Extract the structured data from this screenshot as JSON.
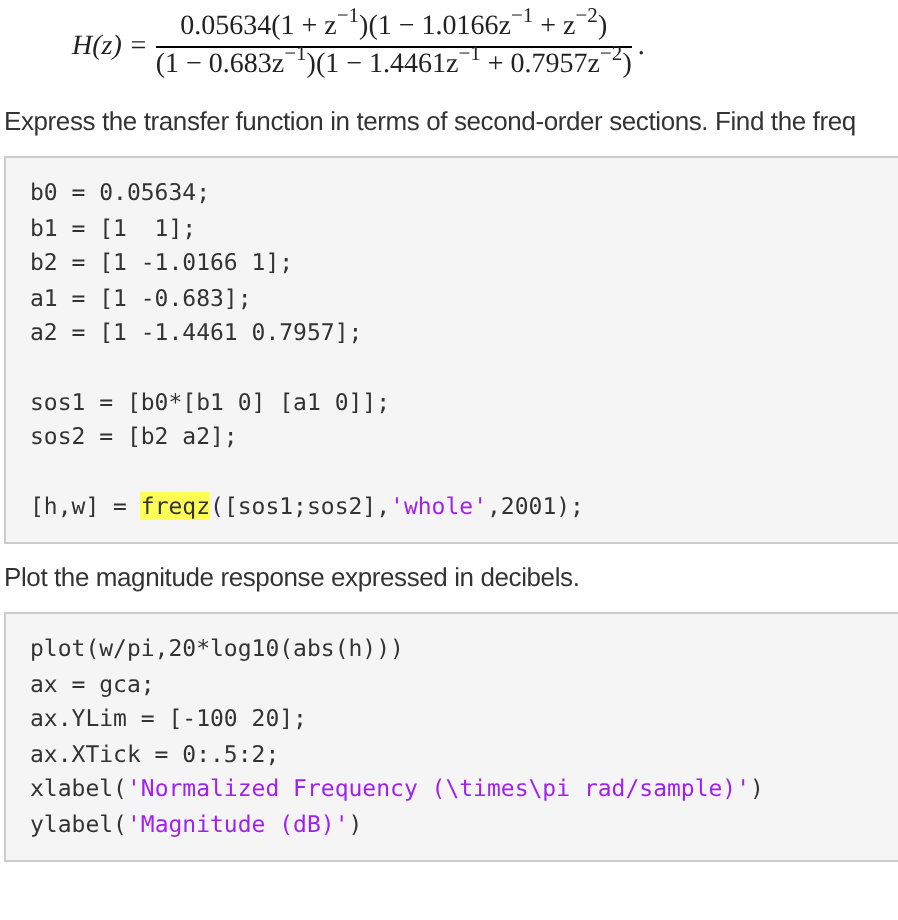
{
  "equation": {
    "lhs": "H(z) =",
    "numerator": "0.05634(1 + z$^{−1}$)(1 − 1.0166z$^{−1}$ + z$^{−2}$)",
    "denominator": "(1 − 0.683z$^{−1}$)(1 − 1.4461z$^{−1}$ + 0.7957z$^{−2}$)",
    "end": "."
  },
  "sections": [
    {
      "text": "Express the transfer function in terms of second-order sections. Find the freq",
      "code": [
        [
          [
            {
              "kind": "plain",
              "text": "b0 = 0.05634;"
            }
          ],
          [
            {
              "kind": "plain",
              "text": "b1 = [1  1];"
            }
          ],
          [
            {
              "kind": "plain",
              "text": "b2 = [1 -1.0166 1];"
            }
          ],
          [
            {
              "kind": "plain",
              "text": "a1 = [1 -0.683];"
            }
          ],
          [
            {
              "kind": "plain",
              "text": "a2 = [1 -1.4461 0.7957];"
            }
          ]
        ],
        [
          [
            {
              "kind": "plain",
              "text": "sos1 = [b0*[b1 0] [a1 0]];"
            }
          ],
          [
            {
              "kind": "plain",
              "text": "sos2 = [b2 a2];"
            }
          ]
        ],
        [
          [
            {
              "kind": "plain",
              "text": "[h,w] = "
            },
            {
              "kind": "highlight",
              "text": "freqz"
            },
            {
              "kind": "plain",
              "text": "([sos1;sos2],"
            },
            {
              "kind": "string",
              "text": "'whole'"
            },
            {
              "kind": "plain",
              "text": ",2001);"
            }
          ]
        ]
      ]
    },
    {
      "text": "Plot the magnitude response expressed in decibels.",
      "code": [
        [
          [
            {
              "kind": "plain",
              "text": "plot(w/pi,20*log10(abs(h)))"
            }
          ],
          [
            {
              "kind": "plain",
              "text": "ax = gca;"
            }
          ],
          [
            {
              "kind": "plain",
              "text": "ax.YLim = [-100 20];"
            }
          ],
          [
            {
              "kind": "plain",
              "text": "ax.XTick = 0:.5:2;"
            }
          ],
          [
            {
              "kind": "plain",
              "text": "xlabel("
            },
            {
              "kind": "string",
              "text": "'Normalized Frequency (\\times\\pi rad/sample)'"
            },
            {
              "kind": "plain",
              "text": ")"
            }
          ],
          [
            {
              "kind": "plain",
              "text": "ylabel("
            },
            {
              "kind": "string",
              "text": "'Magnitude (dB)'"
            },
            {
              "kind": "plain",
              "text": ")"
            }
          ]
        ]
      ]
    }
  ]
}
